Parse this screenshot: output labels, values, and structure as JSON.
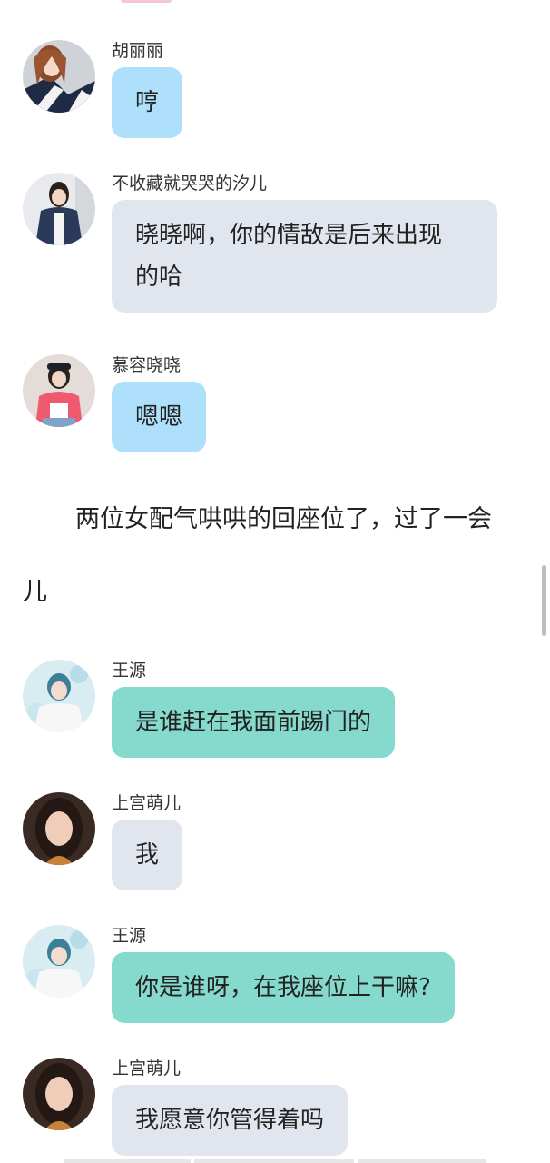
{
  "messages": [
    {
      "sender": "胡丽丽",
      "text": "哼"
    },
    {
      "sender": "不收藏就哭哭的汐儿",
      "line1": "晓晓啊，你的情敌是后来出现",
      "line2": "的哈"
    },
    {
      "sender": "慕容晓晓",
      "text": "嗯嗯"
    },
    {
      "sender": "王源",
      "text": "是谁赶在我面前踢门的"
    },
    {
      "sender": "上宫萌儿",
      "text": "我"
    },
    {
      "sender": "王源",
      "text": "你是谁呀，在我座位上干嘛?"
    },
    {
      "sender": "上宫萌儿",
      "text": "我愿意你管得着吗"
    }
  ],
  "narration": {
    "line1": "两位女配气哄哄的回座位了，过了一会",
    "line2": "儿"
  },
  "colors": {
    "bubble_blue": "#aee0fb",
    "bubble_gray": "#e1e6ee",
    "bubble_teal": "#86dacd"
  }
}
